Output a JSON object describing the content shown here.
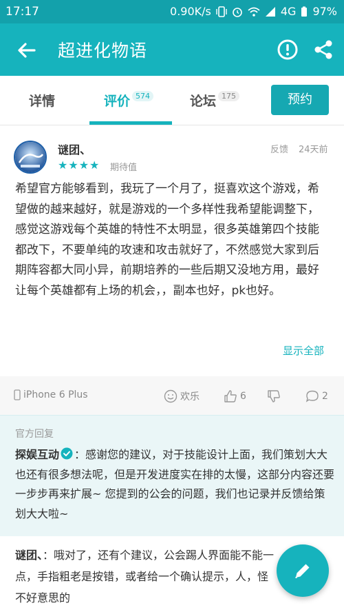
{
  "status_bar": {
    "time": "17:17",
    "speed": "0.90K/s",
    "network": "4G",
    "battery": "97%"
  },
  "app_bar": {
    "title": "超进化物语",
    "icons": [
      "back-arrow-icon",
      "alert-icon",
      "share-icon"
    ]
  },
  "tabs": [
    {
      "label": "详情",
      "count": ""
    },
    {
      "label": "评价",
      "count": "574",
      "active": true
    },
    {
      "label": "论坛",
      "count": "175"
    }
  ],
  "reserve_label": "预约",
  "review": {
    "username": "谜团、",
    "stars": "★★★★",
    "rating_label": "期待值",
    "feedback_label": "反馈",
    "time": "24天前",
    "body": "希望官方能够看到，我玩了一个月了，挺喜欢这个游戏，希望做的越来越好，就是游戏的一个多样性我希望能调整下，感觉这游戏每个英雄的特性不太明显，很多英雄第四个技能都改下，不要单纯的攻速和攻击就好了，不然感觉大家到后期阵容都大同小异，前期培养的一些后期又没地方用，最好让每个英雄都有上场的机会，，副本也好，pk也好。",
    "show_all": "显示全部"
  },
  "meta": {
    "device": "iPhone 6 Plus",
    "mood": "欢乐",
    "likes": "6",
    "comments": "2"
  },
  "official_reply": {
    "label": "官方回复",
    "author": "探娱互动",
    "text": "：感谢您的建议，对于技能设计上面，我们策划大大也还有很多想法呢，但是开发进度实在排的太慢，这部分内容还要一步步再来扩展~ 您提到的公会的问题，我们也记录并反馈给策划大大啦~"
  },
  "user_reply": {
    "author": "谜团、",
    "text": "：哦对了，还有个建议，公会踢人界面能不能一点，手指粗老是按错，或者给一个确认提示，人，怪不好意思的"
  },
  "colors": {
    "primary": "#16b3bd",
    "status_bar": "#13a1ab"
  }
}
